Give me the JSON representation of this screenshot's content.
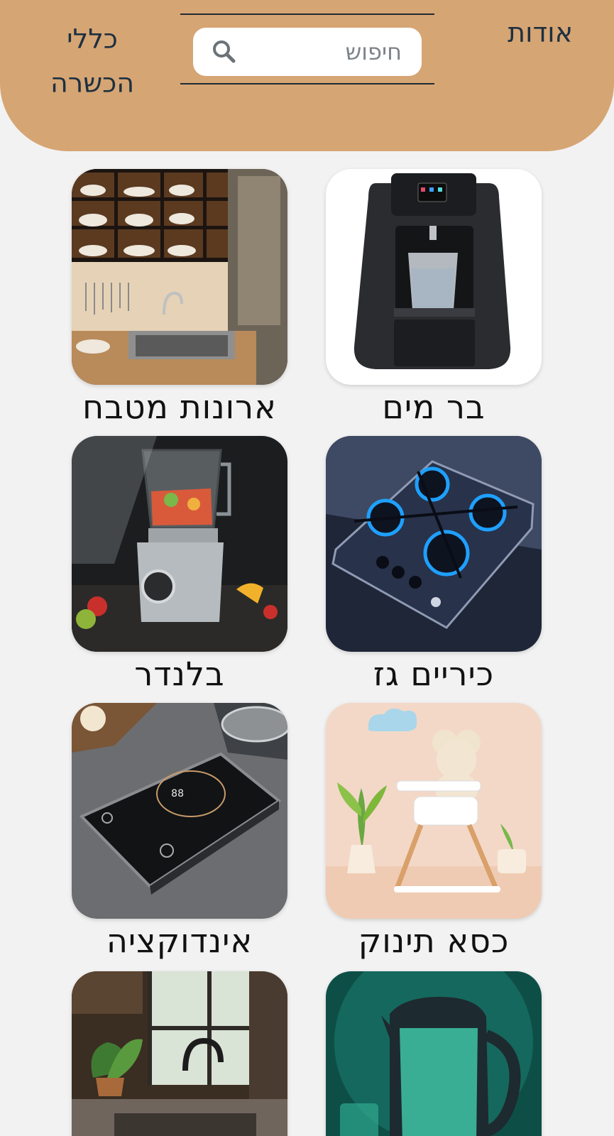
{
  "header": {
    "about_label": "אודות",
    "rules_label_line1": "כללי",
    "rules_label_line2": "הכשרה",
    "search_placeholder": "חיפוש",
    "bg_color": "#d6a574"
  },
  "products": [
    {
      "label": "בר מים",
      "icon": "water-bar-image"
    },
    {
      "label": "ארונות מטבח",
      "icon": "kitchen-cabinets-image"
    },
    {
      "label": "כיריים גז",
      "icon": "gas-stove-image"
    },
    {
      "label": "בלנדר",
      "icon": "blender-image"
    },
    {
      "label": "כסא תינוק",
      "icon": "baby-chair-image"
    },
    {
      "label": "אינדוקציה",
      "icon": "induction-image"
    },
    {
      "label": "",
      "icon": "kettle-image"
    },
    {
      "label": "",
      "icon": "kitchen-faucet-image"
    }
  ]
}
